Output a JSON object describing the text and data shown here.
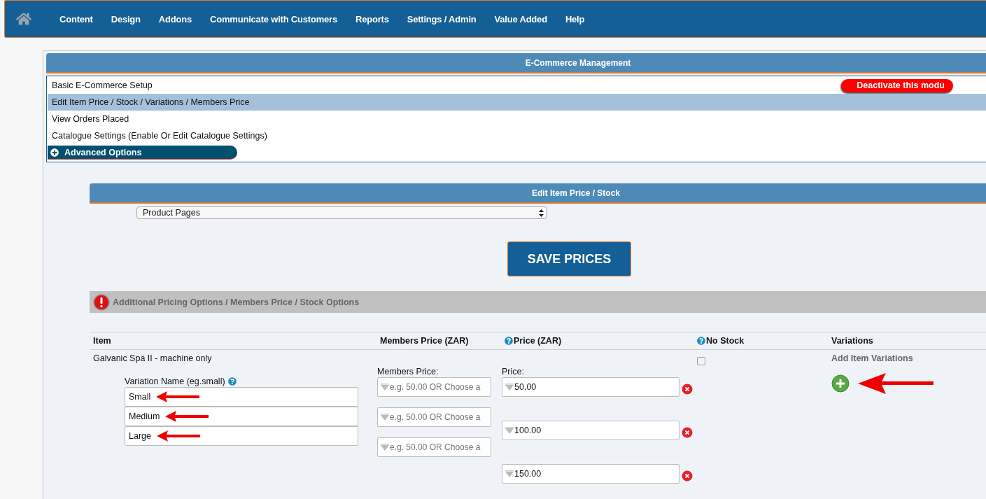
{
  "nav": {
    "items": [
      "Content",
      "Design",
      "Addons",
      "Communicate with Customers",
      "Reports",
      "Settings / Admin",
      "Value Added",
      "Help"
    ]
  },
  "module": {
    "title": "E-Commerce Management",
    "menu": [
      {
        "label": "Basic E-Commerce Setup",
        "selected": false
      },
      {
        "label": "Edit Item Price / Stock / Variations / Members Price",
        "selected": true
      },
      {
        "label": "View Orders Placed",
        "selected": false
      },
      {
        "label": "Catalogue Settings (Enable Or Edit Catalogue Settings)",
        "selected": false
      }
    ],
    "advanced_button": "Advanced Options",
    "deactivate_button": "Deactivate this modu"
  },
  "editor": {
    "title": "Edit Item Price / Stock",
    "page_select": "Product Pages",
    "save_button": "SAVE PRICES",
    "section_title": "Additional Pricing Options / Members Price / Stock Options",
    "columns": [
      {
        "label": "Item",
        "help": false
      },
      {
        "label": "Members Price (ZAR)",
        "help": false
      },
      {
        "label": "Price (ZAR)",
        "help": true
      },
      {
        "label": "No Stock",
        "help": true
      },
      {
        "label": "Variations",
        "help": false
      }
    ],
    "row": {
      "item": "Galvanic Spa II - machine only",
      "variation_label": "Variation Name (eg.small)",
      "members_label": "Members Price:",
      "price_label": "Price:",
      "no_stock": false,
      "add_variations": "Add Item Variations",
      "variations": [
        {
          "name": "Small",
          "members_placeholder": "e.g. 50.00 OR Choose a",
          "price": "50.00"
        },
        {
          "name": "Medium",
          "members_placeholder": "e.g. 50.00 OR Choose a",
          "price": "100.00"
        },
        {
          "name": "Large",
          "members_placeholder": "e.g. 50.00 OR Choose a",
          "price": "150.00"
        }
      ]
    }
  }
}
